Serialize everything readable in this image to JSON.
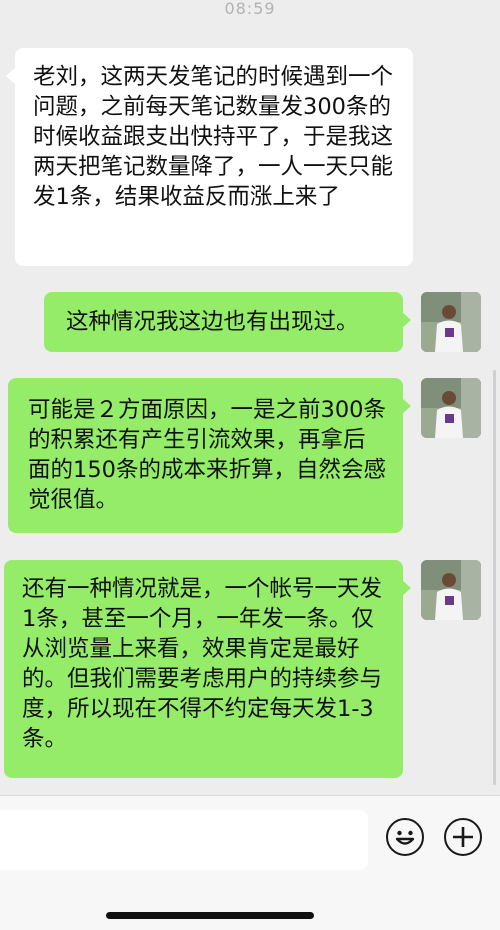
{
  "status_bar": {
    "time": "08:59"
  },
  "messages": [
    {
      "sender": "other",
      "text": "老刘，这两天发笔记的时候遇到一个问题，之前每天笔记数量发300条的时候收益跟支出快持平了，于是我这两天把笔记数量降了，一人一天只能发1条，结果收益反而涨上来了"
    },
    {
      "sender": "self",
      "text": "这种情况我这边也有出现过。"
    },
    {
      "sender": "self",
      "text": "可能是２方面原因，一是之前300条的积累还有产生引流效果，再拿后面的150条的成本来折算，自然会感觉很值。"
    },
    {
      "sender": "self",
      "text": "还有一种情况就是，一个帐号一天发1条，甚至一个月，一年发一条。仅从浏览量上来看，效果肯定是最好的。但我们需要考虑用户的持续参与度，所以现在不得不约定每天发1-3条。"
    }
  ],
  "input_bar": {
    "text_value": "",
    "emoji_icon": "smiley-face-icon",
    "plus_icon": "plus-circle-icon"
  },
  "colors": {
    "background": "#ededed",
    "self_bubble": "#95ec69",
    "other_bubble": "#ffffff"
  }
}
